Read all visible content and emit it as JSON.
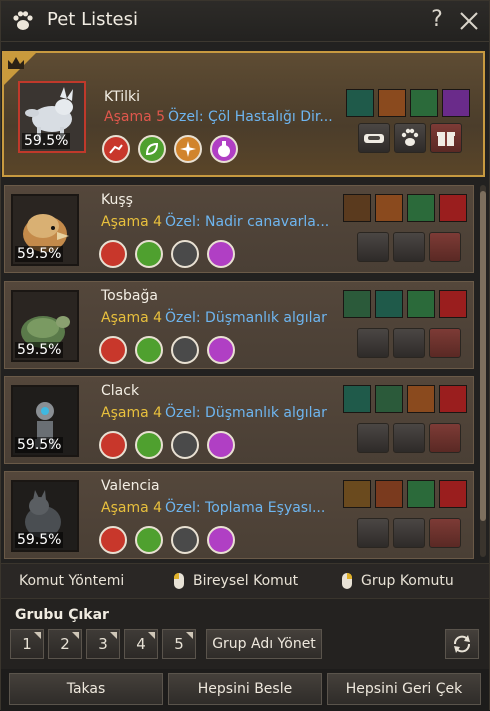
{
  "window": {
    "title": "Pet Listesi",
    "help_label": "?"
  },
  "pets": [
    {
      "name": "KTilki",
      "stage": "Aşama 5",
      "special": "Özel: Çöl Hastalığı Dir...",
      "food": "59.5%",
      "selected": true,
      "stage_color": "#e0574c"
    },
    {
      "name": "Kuşş",
      "stage": "Aşama 4",
      "special": "Özel: Nadir canavarla...",
      "food": "59.5%",
      "selected": false,
      "stage_color": "#e8c03d"
    },
    {
      "name": "Tosbağa",
      "stage": "Aşama 4",
      "special": "Özel: Düşmanlık algılar",
      "food": "59.5%",
      "selected": false,
      "stage_color": "#e8c03d"
    },
    {
      "name": "Clack",
      "stage": "Aşama 4",
      "special": "Özel: Düşmanlık algılar",
      "food": "59.5%",
      "selected": false,
      "stage_color": "#e8c03d"
    },
    {
      "name": "Valencia",
      "stage": "Aşama 4",
      "special": "Özel: Toplama Eşyası...",
      "food": "59.5%",
      "selected": false,
      "stage_color": "#e8c03d"
    }
  ],
  "command_bar": {
    "method_label": "Komut Yöntemi",
    "individual_label": "Bireysel Komut",
    "group_label": "Grup Komutu"
  },
  "groups": {
    "header": "Grubu Çıkar",
    "numbers": [
      "1",
      "2",
      "3",
      "4",
      "5"
    ],
    "manage_label": "Grup Adı Yönet"
  },
  "footer": {
    "exchange_label": "Takas",
    "feed_all_label": "Hepsini Besle",
    "recall_all_label": "Hepsini Geri Çek"
  },
  "colors": {
    "accent_gold": "#c89a40",
    "special_blue": "#6eb5ef",
    "stage_yellow": "#e8c03d",
    "stage_red": "#e0574c"
  },
  "icons": {
    "title": "paw-icon",
    "close": "close-icon",
    "refresh": "refresh-icon",
    "round_buttons": [
      "red-pet-command-icon",
      "green-pet-command-icon",
      "orange-pet-command-icon",
      "purple-pet-command-icon"
    ],
    "square_buttons": [
      "feed-bowl-icon",
      "paw-care-icon",
      "gift-box-icon"
    ]
  }
}
